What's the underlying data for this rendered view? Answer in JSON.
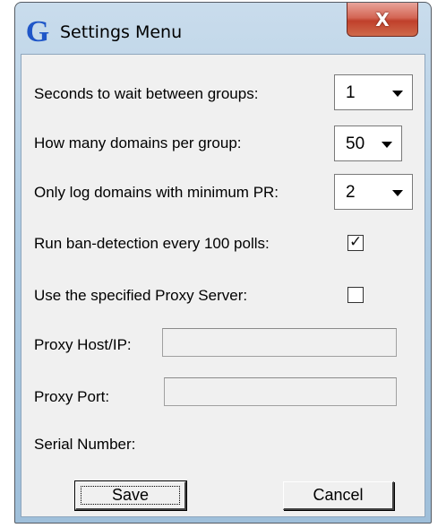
{
  "window": {
    "title": "Settings Menu",
    "app_icon_glyph": "G",
    "close_glyph": "X"
  },
  "settings": {
    "wait_seconds": {
      "label": "Seconds to wait between groups:",
      "value": "1"
    },
    "domains_per_group": {
      "label": "How many domains per group:",
      "value": "50"
    },
    "min_pr": {
      "label": "Only log domains with minimum PR:",
      "value": "2"
    },
    "ban_detection": {
      "label": "Run ban-detection every 100 polls:",
      "checked": true,
      "check_glyph": "✓"
    },
    "use_proxy": {
      "label": "Use the specified Proxy Server:",
      "checked": false
    },
    "proxy_host": {
      "label": "Proxy Host/IP:",
      "value": ""
    },
    "proxy_port": {
      "label": "Proxy Port:",
      "value": ""
    },
    "serial_number": {
      "label": "Serial Number:"
    }
  },
  "buttons": {
    "save": "Save",
    "cancel": "Cancel"
  },
  "colors": {
    "close_button": "#c0402b",
    "app_icon": "#1f56c8",
    "client_background": "#f0f0f0"
  }
}
